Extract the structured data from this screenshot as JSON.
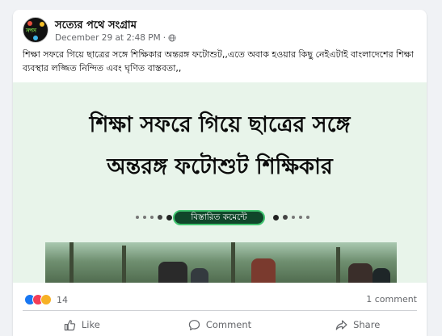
{
  "post": {
    "page_name": "সত্যের পথে সংগ্রাম",
    "timestamp": "December 29 at 2:48 PM",
    "separator": "·",
    "audience_icon": "globe-icon",
    "caption": "শিক্ষা সফরে গিয়ে ছাত্রের সঙ্গে শিক্ষিকার অন্তরঙ্গ ফটোশুট,,এতে অবাক হওয়ার কিছু নেইএটাই বাংলাদেশের শিক্ষা ব্যবস্থার লজ্জিত নিন্দিত এবং ঘৃণিত  বাস্তবতা,,"
  },
  "image": {
    "headline_line1": "শিক্ষা সফরে গিয়ে ছাত্রের সঙ্গে",
    "headline_line2": "অন্তরঙ্গ ফটোশুট শিক্ষিকার",
    "pill_label": "বিস্তারিত কমেন্টে"
  },
  "stats": {
    "reactions": [
      "like",
      "love",
      "haha"
    ],
    "reaction_count": "14",
    "comment_count": "1 comment"
  },
  "actions": {
    "like": "Like",
    "comment": "Comment",
    "share": "Share"
  },
  "colors": {
    "accent": "#1877f2",
    "pill_bg": "#10462a",
    "pill_border": "#40c36f",
    "image_bg": "#e8f4ea"
  }
}
